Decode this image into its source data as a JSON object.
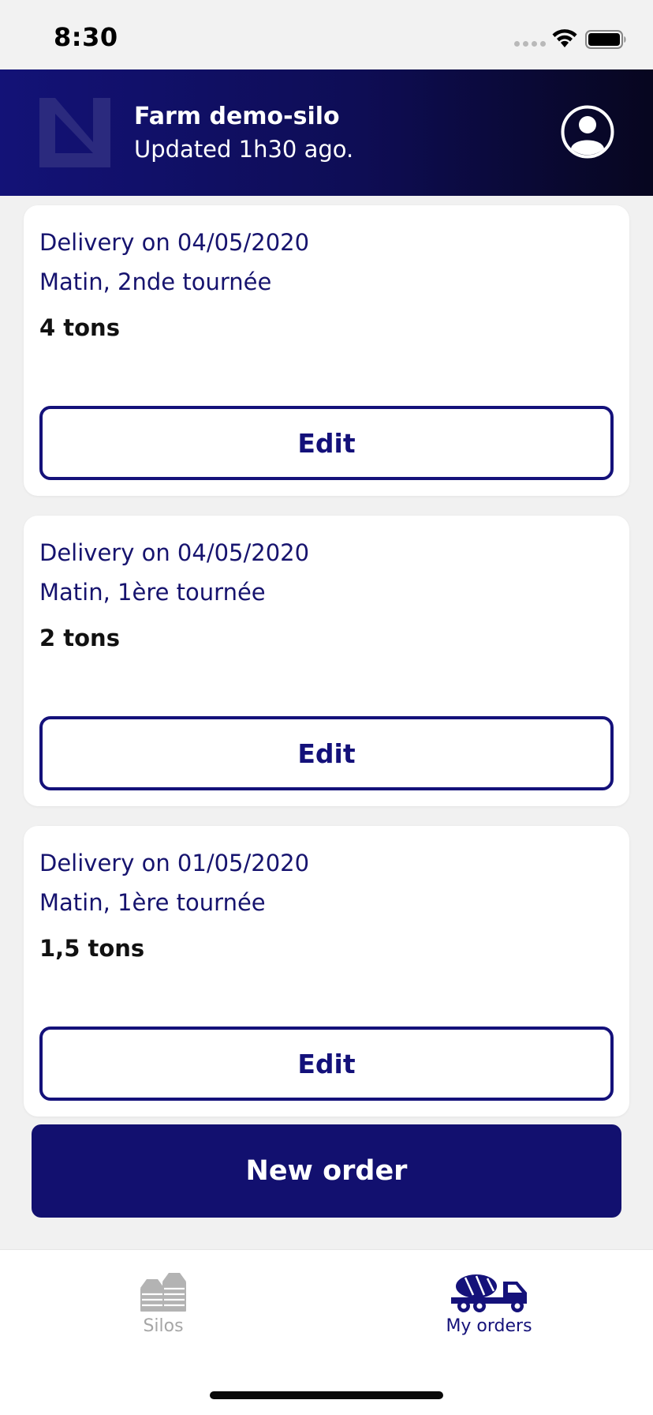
{
  "status_bar": {
    "time": "8:30"
  },
  "header": {
    "title": "Farm demo-silo",
    "subtitle": "Updated 1h30 ago."
  },
  "orders": [
    {
      "date": "Delivery on 04/05/2020",
      "slot": "Matin, 2nde tournée",
      "quantity": "4 tons",
      "edit_label": "Edit"
    },
    {
      "date": "Delivery on 04/05/2020",
      "slot": "Matin, 1ère tournée",
      "quantity": "2 tons",
      "edit_label": "Edit"
    },
    {
      "date": "Delivery on 01/05/2020",
      "slot": "Matin, 1ère tournée",
      "quantity": "1,5 tons",
      "edit_label": "Edit"
    }
  ],
  "new_order_label": "New order",
  "tabs": [
    {
      "label": "Silos",
      "icon": "silo-icon",
      "active": false
    },
    {
      "label": "My orders",
      "icon": "truck-icon",
      "active": true
    }
  ],
  "colors": {
    "primary": "#12106f",
    "header_start": "#131277",
    "header_end": "#07061f",
    "inactive_tab": "#a6a6a6",
    "background": "#f1f1f1"
  }
}
